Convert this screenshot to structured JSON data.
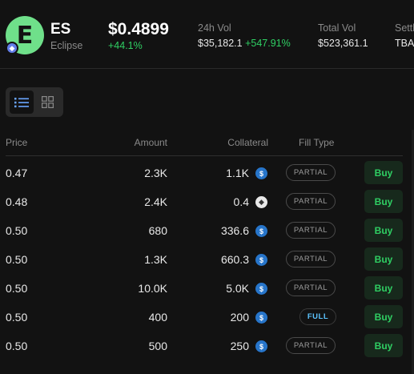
{
  "token": {
    "symbol": "ES",
    "name": "Eclipse",
    "logo_letter": "E",
    "logo_color": "#6fe08a",
    "chain_icon": "ethereum-icon",
    "price": "$0.4899",
    "change": "+44.1%"
  },
  "stats": {
    "vol24h_label": "24h Vol",
    "vol24h_value": "$35,182.1",
    "vol24h_change": "+547.91%",
    "total_vol_label": "Total Vol",
    "total_vol_value": "$523,361.1",
    "settle_label": "Settle",
    "settle_value": "TBA"
  },
  "view_toggle": {
    "active": "list",
    "list_icon": "list-view-icon",
    "grid_icon": "grid-view-icon"
  },
  "table": {
    "headers": {
      "price": "Price",
      "amount": "Amount",
      "collateral": "Collateral",
      "fill_type": "Fill Type"
    },
    "rows": [
      {
        "price": "0.47",
        "amount": "2.3K",
        "collateral": "1.1K",
        "coin": "usdc",
        "fill": "PARTIAL",
        "action": "Buy"
      },
      {
        "price": "0.48",
        "amount": "2.4K",
        "collateral": "0.4",
        "coin": "eth",
        "fill": "PARTIAL",
        "action": "Buy"
      },
      {
        "price": "0.50",
        "amount": "680",
        "collateral": "336.6",
        "coin": "usdc",
        "fill": "PARTIAL",
        "action": "Buy"
      },
      {
        "price": "0.50",
        "amount": "1.3K",
        "collateral": "660.3",
        "coin": "usdc",
        "fill": "PARTIAL",
        "action": "Buy"
      },
      {
        "price": "0.50",
        "amount": "10.0K",
        "collateral": "5.0K",
        "coin": "usdc",
        "fill": "PARTIAL",
        "action": "Buy"
      },
      {
        "price": "0.50",
        "amount": "400",
        "collateral": "200",
        "coin": "usdc",
        "fill": "FULL",
        "action": "Buy"
      },
      {
        "price": "0.50",
        "amount": "500",
        "collateral": "250",
        "coin": "usdc",
        "fill": "PARTIAL",
        "action": "Buy"
      }
    ]
  },
  "colors": {
    "background": "#121212",
    "positive": "#2fcf63",
    "full_badge": "#5cc4ff",
    "usdc": "#2775ca"
  }
}
